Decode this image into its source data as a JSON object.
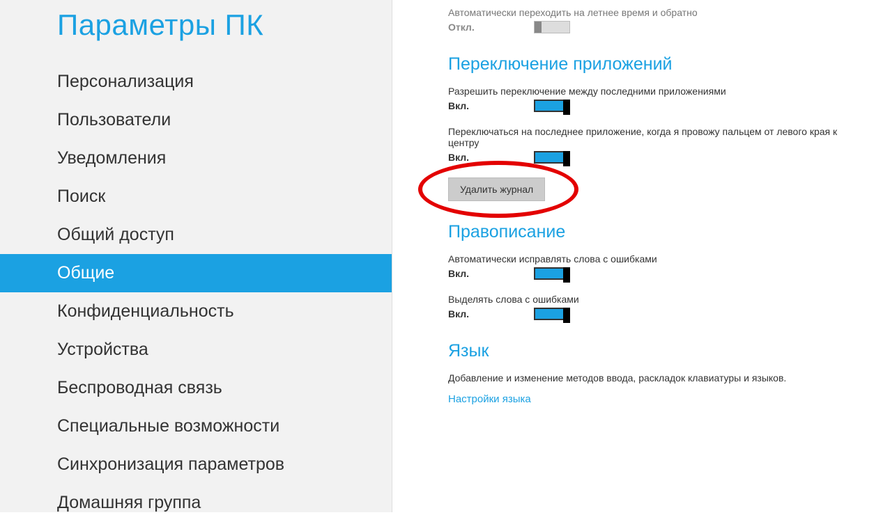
{
  "sidebar": {
    "title": "Параметры ПК",
    "items": [
      {
        "label": "Персонализация",
        "selected": false
      },
      {
        "label": "Пользователи",
        "selected": false
      },
      {
        "label": "Уведомления",
        "selected": false
      },
      {
        "label": "Поиск",
        "selected": false
      },
      {
        "label": "Общий доступ",
        "selected": false
      },
      {
        "label": "Общие",
        "selected": true
      },
      {
        "label": "Конфиденциальность",
        "selected": false
      },
      {
        "label": "Устройства",
        "selected": false
      },
      {
        "label": "Беспроводная связь",
        "selected": false
      },
      {
        "label": "Специальные возможности",
        "selected": false
      },
      {
        "label": "Синхронизация параметров",
        "selected": false
      },
      {
        "label": "Домашняя группа",
        "selected": false
      }
    ]
  },
  "content": {
    "dst": {
      "desc": "Автоматически переходить на летнее время и обратно",
      "state_label": "Откл.",
      "on": false
    },
    "app_switch": {
      "title": "Переключение приложений",
      "allow_switch": {
        "desc": "Разрешить переключение между последними приложениями",
        "state_label": "Вкл.",
        "on": true
      },
      "edge_swipe": {
        "desc": "Переключаться на последнее приложение, когда я провожу пальцем от левого края к центру",
        "state_label": "Вкл.",
        "on": true
      },
      "delete_button": "Удалить журнал"
    },
    "spelling": {
      "title": "Правописание",
      "autocorrect": {
        "desc": "Автоматически исправлять слова с ошибками",
        "state_label": "Вкл.",
        "on": true
      },
      "highlight": {
        "desc": "Выделять слова с ошибками",
        "state_label": "Вкл.",
        "on": true
      }
    },
    "language": {
      "title": "Язык",
      "desc": "Добавление и изменение методов ввода, раскладок клавиатуры и языков.",
      "link": "Настройки языка"
    }
  },
  "annotation": {
    "ellipse_color": "#e30000"
  }
}
